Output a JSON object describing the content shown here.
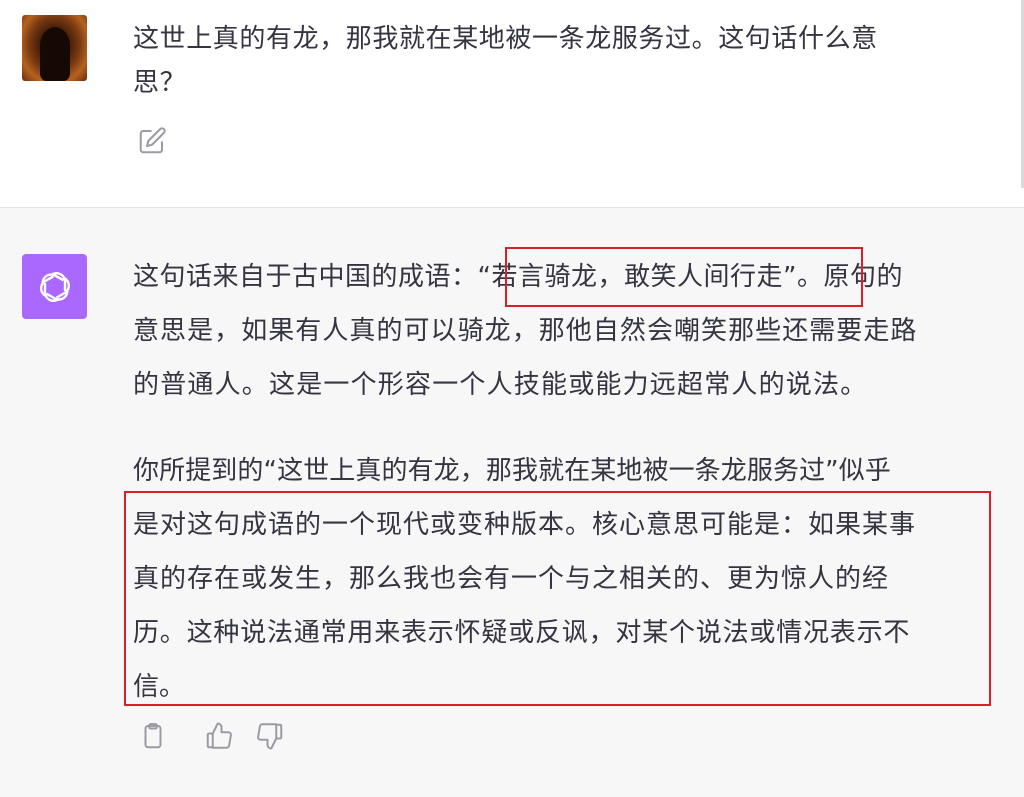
{
  "user_message": {
    "line1": "这世上真的有龙，那我就在某地被一条龙服务过。这句话什么意",
    "line2": "思？"
  },
  "assistant_message": {
    "paragraph1": {
      "line1": "这句话来自于古中国的成语：“若言骑龙，敢笑人间行走”。原句的",
      "line2": "意思是，如果有人真的可以骑龙，那他自然会嘲笑那些还需要走路",
      "line3": "的普通人。这是一个形容一个人技能或能力远超常人的说法。"
    },
    "paragraph2": {
      "line1": "你所提到的“这世上真的有龙，那我就在某地被一条龙服务过”似乎",
      "line2": "是对这句成语的一个现代或变种版本。核心意思可能是：如果某事",
      "line3": "真的存在或发生，那么我也会有一个与之相关的、更为惊人的经",
      "line4": "历。这种说法通常用来表示怀疑或反讽，对某个说法或情况表示不",
      "line5": "信。"
    }
  },
  "colors": {
    "annotation_box": "#d6202a",
    "assistant_avatar_bg": "#ab68ff",
    "assistant_bg": "#f7f7f8",
    "text": "#343541",
    "icon": "#9a9ba3"
  },
  "icons": {
    "edit": "edit-icon",
    "copy": "clipboard-icon",
    "like": "thumbs-up-icon",
    "dislike": "thumbs-down-icon",
    "assistant_logo": "openai-logo-icon"
  }
}
